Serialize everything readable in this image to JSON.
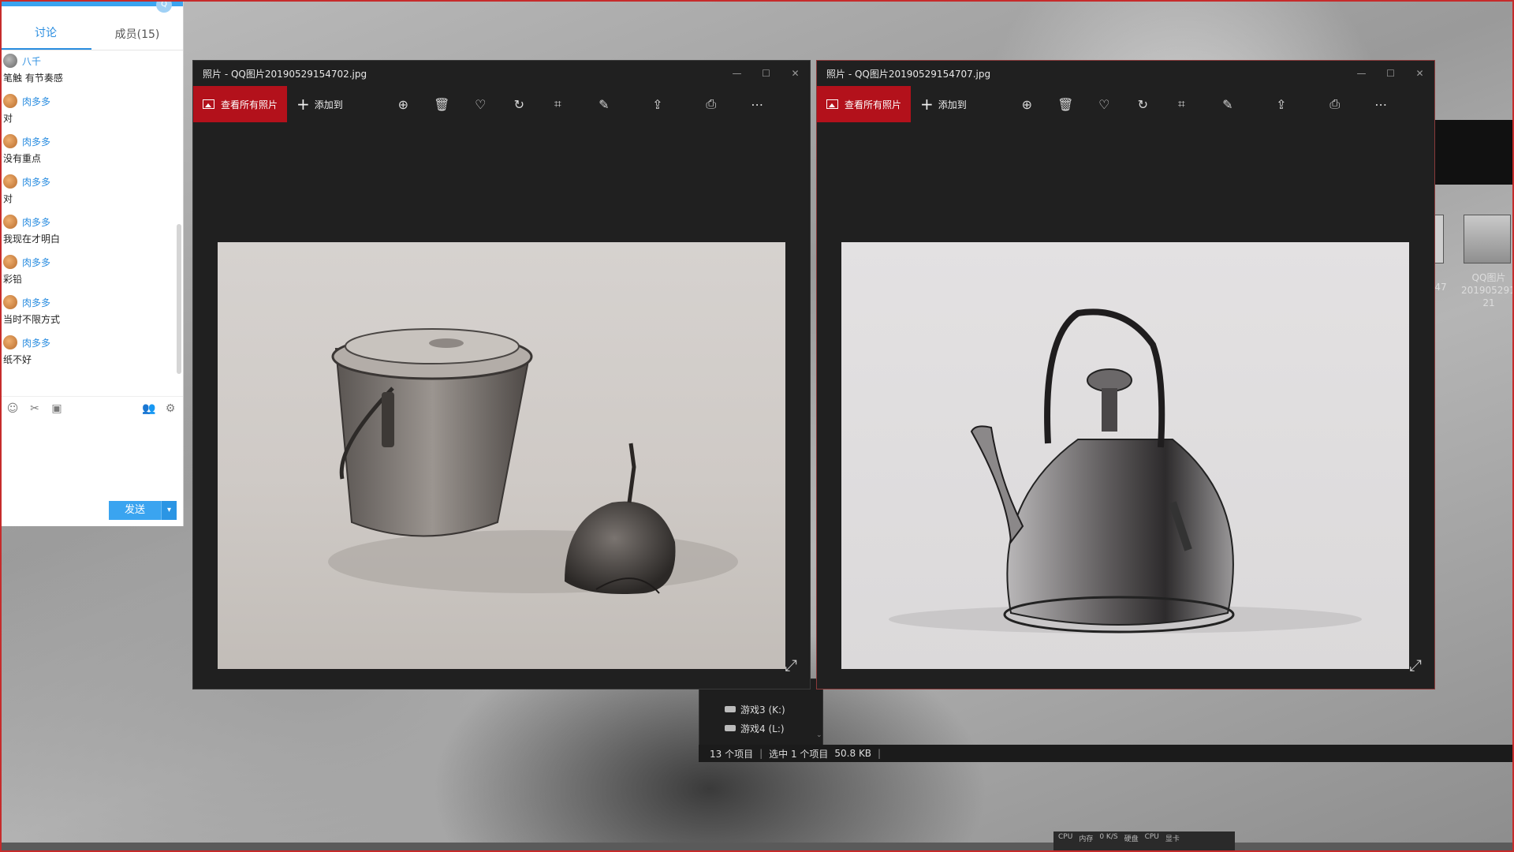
{
  "chat": {
    "badge": "Q",
    "tabs": [
      {
        "label": "讨论",
        "active": true
      },
      {
        "label": "成员(15)",
        "active": false
      }
    ],
    "messages": [
      {
        "name": "八千",
        "text": "笔触 有节奏感"
      },
      {
        "name": "肉多多",
        "text": "对"
      },
      {
        "name": "肉多多",
        "text": "没有重点"
      },
      {
        "name": "肉多多",
        "text": "对"
      },
      {
        "name": "肉多多",
        "text": "我现在才明白"
      },
      {
        "name": "肉多多",
        "text": "彩铅"
      },
      {
        "name": "肉多多",
        "text": "当时不限方式"
      },
      {
        "name": "肉多多",
        "text": "纸不好"
      }
    ],
    "send_label": "发送",
    "send_dropdown": "▾"
  },
  "photo_windows": [
    {
      "title": "照片 - QQ图片20190529154702.jpg",
      "view_all_label": "查看所有照片",
      "add_to_label": "添加到"
    },
    {
      "title": "照片 - QQ图片20190529154707.jpg",
      "view_all_label": "查看所有照片",
      "add_to_label": "添加到"
    }
  ],
  "explorer": {
    "drives": [
      "游戏3 (K:)",
      "游戏4 (L:)"
    ],
    "status": {
      "items": "13 个项目",
      "selected": "选中 1 个项目",
      "size": "50.8 KB"
    }
  },
  "thumbnails": {
    "left_label": "47",
    "right_label_line1": "QQ图片",
    "right_label_line2": "2019052915",
    "right_label_line3": "21"
  },
  "perf": {
    "labels": [
      "CPU",
      "内存",
      "0 K/S",
      "硬盘",
      "CPU",
      "显卡"
    ]
  },
  "colors": {
    "accent_red": "#b3111b",
    "qq_blue": "#3aa4f0",
    "window_bg": "#202020"
  },
  "icons": {
    "cmd": [
      "zoom-in-icon",
      "delete-icon",
      "heart-icon",
      "rotate-icon",
      "crop-icon",
      "edit-icon",
      "share-icon",
      "print-icon",
      "more-icon"
    ]
  }
}
